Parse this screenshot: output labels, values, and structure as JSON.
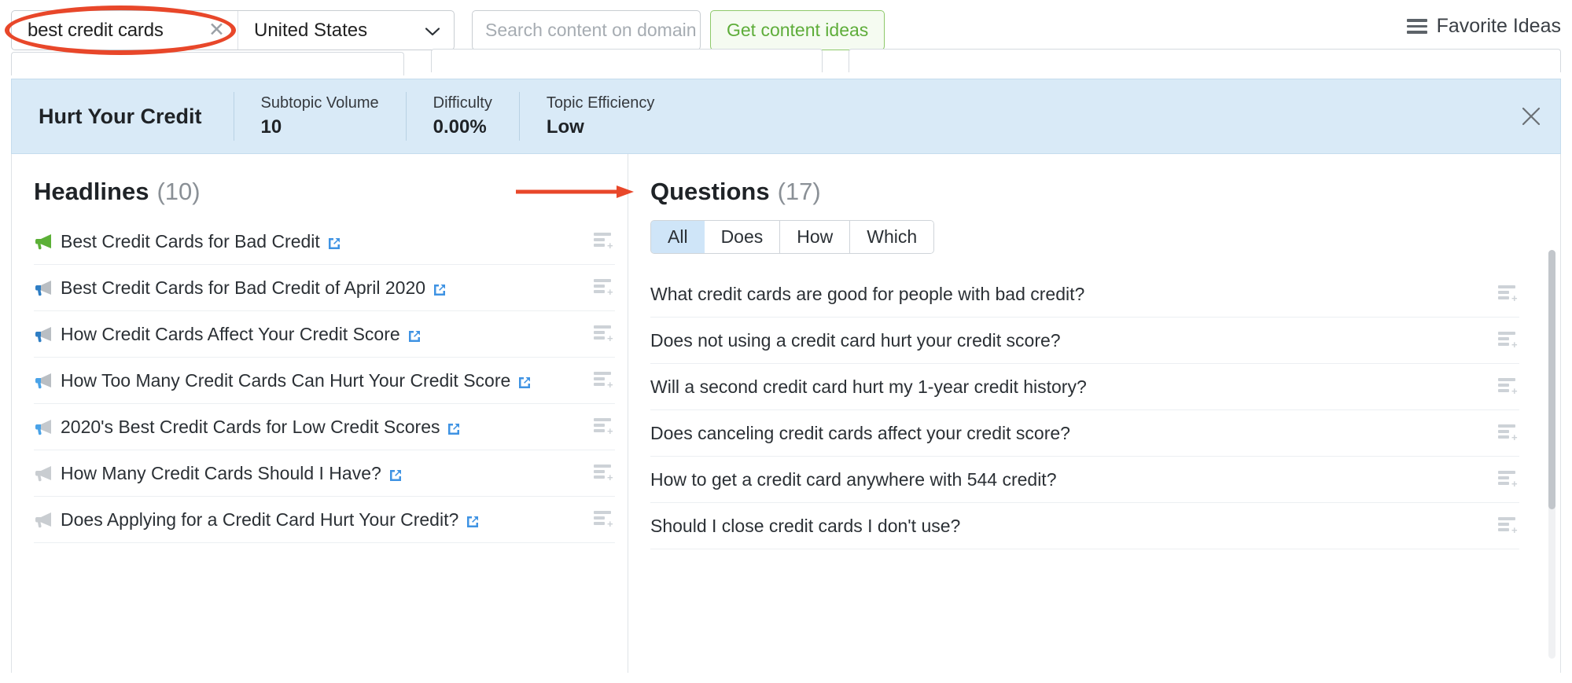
{
  "topbar": {
    "keyword_value": "best credit cards",
    "keyword_placeholder": "Enter keyword",
    "clear_glyph": "✕",
    "country_value": "United States",
    "domain_placeholder": "Search content on domain",
    "domain_value": "",
    "get_ideas_label": "Get content ideas",
    "favorite_ideas_label": "Favorite Ideas"
  },
  "metrics": {
    "title": "Hurt Your Credit",
    "items": [
      {
        "label": "Subtopic Volume",
        "value": "10"
      },
      {
        "label": "Difficulty",
        "value": "0.00%"
      },
      {
        "label": "Topic Efficiency",
        "value": "Low"
      }
    ],
    "close_glyph": "✕"
  },
  "headlines": {
    "title": "Headlines",
    "count": "(10)",
    "items": [
      {
        "text": "Best Credit Cards for Bad Credit",
        "icon_color": "#5cb037"
      },
      {
        "text": "Best Credit Cards for Bad Credit of April 2020",
        "icon_color": "#2f7ec4"
      },
      {
        "text": "How Credit Cards Affect Your Credit Score",
        "icon_color": "#2f7ec4"
      },
      {
        "text": "How Too Many Credit Cards Can Hurt Your Credit Score",
        "icon_color": "#4aa3e8"
      },
      {
        "text": "2020's Best Credit Cards for Low Credit Scores",
        "icon_color": "#4aa3e8"
      },
      {
        "text": "How Many Credit Cards Should I Have?",
        "icon_color": "#c9cdd1"
      },
      {
        "text": "Does Applying for a Credit Card Hurt Your Credit?",
        "icon_color": "#c9cdd1"
      }
    ]
  },
  "questions": {
    "title": "Questions",
    "count": "(17)",
    "tabs": [
      {
        "label": "All",
        "active": true
      },
      {
        "label": "Does",
        "active": false
      },
      {
        "label": "How",
        "active": false
      },
      {
        "label": "Which",
        "active": false
      }
    ],
    "items": [
      {
        "text": "What credit cards are good for people with bad credit?"
      },
      {
        "text": "Does not using a credit card hurt your credit score?"
      },
      {
        "text": "Will a second credit card hurt my 1-year credit history?"
      },
      {
        "text": "Does canceling credit cards affect your credit score?"
      },
      {
        "text": "How to get a credit card anywhere with 544 credit?"
      },
      {
        "text": "Should I close credit cards I don't use?"
      }
    ]
  },
  "colors": {
    "accent_green": "#5ead3a",
    "metrics_bg": "#d9eaf7",
    "tab_active_bg": "#cfe5f8",
    "tab_active_border": "#4a9ae0",
    "annotation_red": "#e8472a",
    "external_link_blue": "#3f93e3"
  }
}
